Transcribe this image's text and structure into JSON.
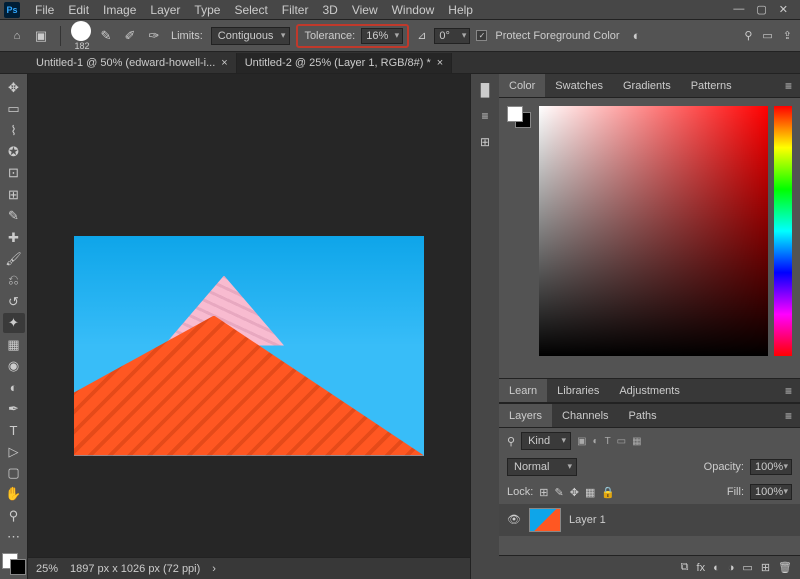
{
  "app": {
    "logo": "Ps"
  },
  "menu": {
    "items": [
      "File",
      "Edit",
      "Image",
      "Layer",
      "Type",
      "Select",
      "Filter",
      "3D",
      "View",
      "Window",
      "Help"
    ]
  },
  "options": {
    "brush_size": "182",
    "limits_label": "Limits:",
    "limits_value": "Contiguous",
    "tolerance_label": "Tolerance:",
    "tolerance_value": "16%",
    "angle_label": "⊿",
    "angle_value": "0°",
    "protect_label": "Protect Foreground Color"
  },
  "tabs": [
    {
      "title": "Untitled-1 @ 50% (edward-howell-i...",
      "active": false
    },
    {
      "title": "Untitled-2 @ 25% (Layer 1, RGB/8#) *",
      "active": true
    }
  ],
  "status": {
    "zoom": "25%",
    "doc": "1897 px x 1026 px (72 ppi)"
  },
  "panels": {
    "color": {
      "tabs": [
        "Color",
        "Swatches",
        "Gradients",
        "Patterns"
      ]
    },
    "learn": {
      "tabs": [
        "Learn",
        "Libraries",
        "Adjustments"
      ]
    },
    "layers": {
      "tabs": [
        "Layers",
        "Channels",
        "Paths"
      ],
      "kind_label": "Kind",
      "blend": "Normal",
      "opacity_label": "Opacity:",
      "opacity": "100%",
      "lock_label": "Lock:",
      "fill_label": "Fill:",
      "fill": "100%",
      "items": [
        {
          "name": "Layer 1"
        }
      ]
    }
  }
}
